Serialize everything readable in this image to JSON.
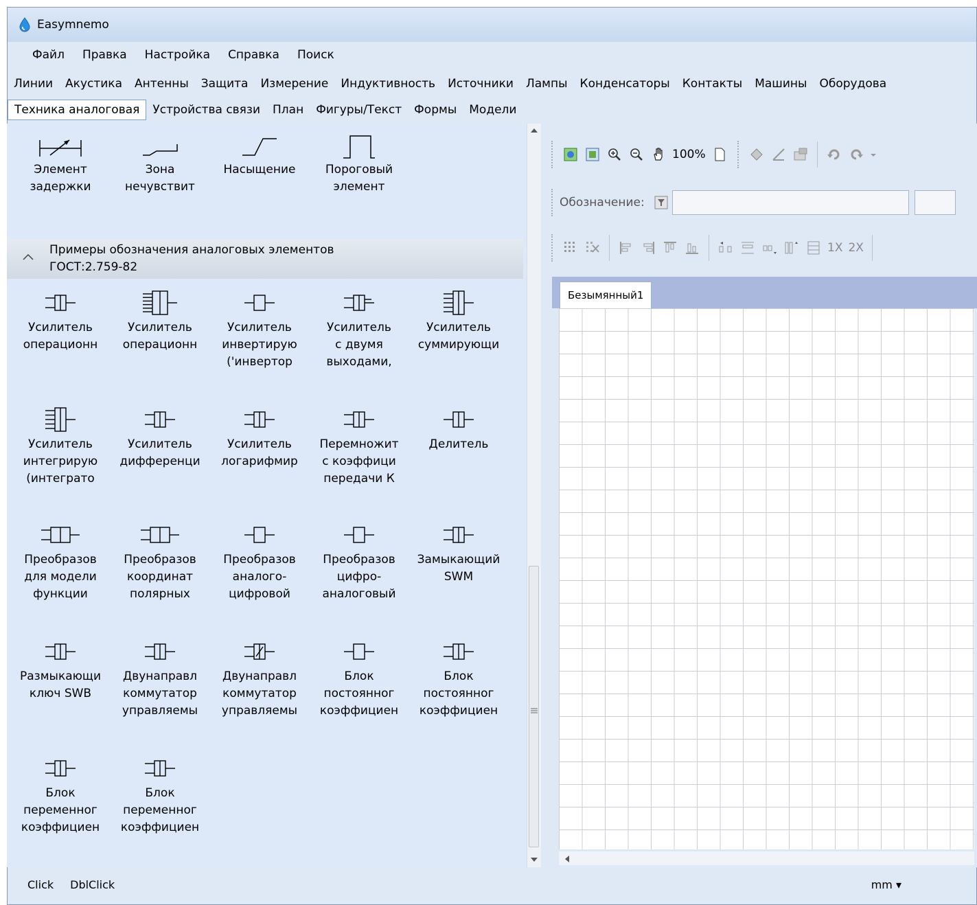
{
  "window": {
    "title": "Easymnemo"
  },
  "menu": [
    "Файл",
    "Правка",
    "Настройка",
    "Справка",
    "Поиск"
  ],
  "category_tabs_row1": [
    "Линии",
    "Акустика",
    "Антенны",
    "Защита",
    "Измерение",
    "Индуктивность",
    "Источники",
    "Лампы",
    "Конденсаторы",
    "Контакты",
    "Машины",
    "Оборудова"
  ],
  "category_tabs_row2": [
    "Техника аналоговая",
    "Устройства связи",
    "План",
    "Фигуры/Текст",
    "Формы",
    "Модели"
  ],
  "active_tab": "Техника аналоговая",
  "palette": {
    "top_items": [
      {
        "line1": "Элемент",
        "line2": "задержки",
        "line3": ""
      },
      {
        "line1": "Зона",
        "line2": "нечувствит",
        "line3": ""
      },
      {
        "line1": "Насыщение",
        "line2": "",
        "line3": ""
      },
      {
        "line1": "Пороговый",
        "line2": "элемент",
        "line3": ""
      }
    ],
    "section_title_line1": "Примеры обозначения аналоговых элементов",
    "section_title_line2": "ГОСТ:2.759-82",
    "items": [
      {
        "line1": "Усилитель",
        "line2": "операционн",
        "line3": ""
      },
      {
        "line1": "Усилитель",
        "line2": "операционн",
        "line3": ""
      },
      {
        "line1": "Усилитель",
        "line2": "инвертирую",
        "line3": "('инвертор"
      },
      {
        "line1": "Усилитель",
        "line2": "с двумя",
        "line3": "выходами,"
      },
      {
        "line1": "Усилитель",
        "line2": "суммирующи",
        "line3": ""
      },
      {
        "line1": "Усилитель",
        "line2": "интегрирую",
        "line3": "(интеграто"
      },
      {
        "line1": "Усилитель",
        "line2": "дифференци",
        "line3": ""
      },
      {
        "line1": "Усилитель",
        "line2": "логарифмир",
        "line3": ""
      },
      {
        "line1": "Перемножит",
        "line2": "с коэффици",
        "line3": "передачи К"
      },
      {
        "line1": "Делитель",
        "line2": "",
        "line3": ""
      },
      {
        "line1": "Преобразов",
        "line2": "для модели",
        "line3": "функции"
      },
      {
        "line1": "Преобразов",
        "line2": "координат",
        "line3": "полярных"
      },
      {
        "line1": "Преобразов",
        "line2": "аналого-",
        "line3": "цифровой"
      },
      {
        "line1": "Преобразов",
        "line2": "цифро-",
        "line3": "аналоговый"
      },
      {
        "line1": "Замыкающий",
        "line2": "SWM",
        "line3": ""
      },
      {
        "line1": "Размыкающи",
        "line2": "ключ SWB",
        "line3": ""
      },
      {
        "line1": "Двунаправл",
        "line2": "коммутатор",
        "line3": "управляемы"
      },
      {
        "line1": "Двунаправл",
        "line2": "коммутатор",
        "line3": "управляемы"
      },
      {
        "line1": "Блок",
        "line2": "постоянног",
        "line3": "коэффициен"
      },
      {
        "line1": "Блок",
        "line2": "постоянног",
        "line3": "коэффициен"
      },
      {
        "line1": "Блок",
        "line2": "переменног",
        "line3": "коэффициен"
      },
      {
        "line1": "Блок",
        "line2": "переменног",
        "line3": "коэффициен"
      }
    ]
  },
  "toolbar": {
    "zoom": "100%",
    "designation_label": "Обозначение:",
    "designation_value": "",
    "scale_1x": "1X",
    "scale_2x": "2X"
  },
  "document": {
    "tab": "Безымянный1"
  },
  "status": {
    "click": "Click",
    "dblclick": "DblClick",
    "units": "mm ▾"
  }
}
